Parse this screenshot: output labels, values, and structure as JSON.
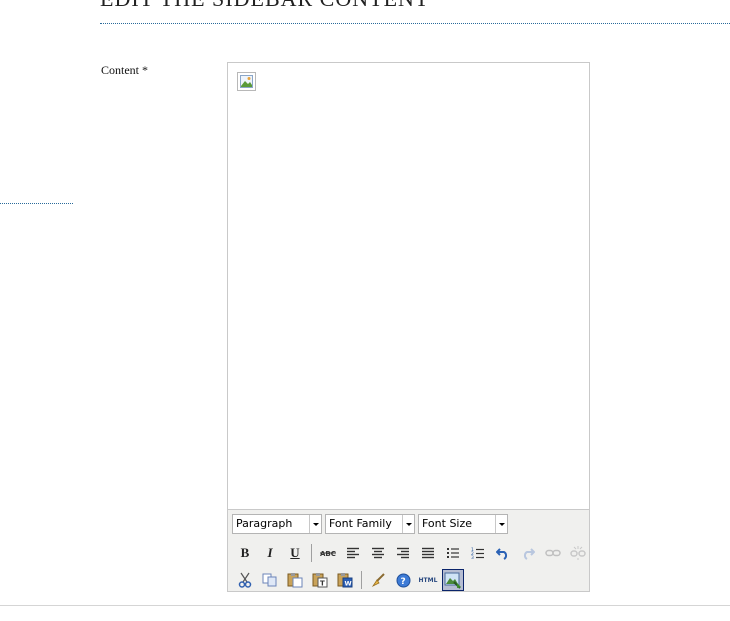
{
  "page": {
    "title": "EDIT THE SIDEBAR CONTENT"
  },
  "form": {
    "content_label": "Content *"
  },
  "editor": {
    "format_select": "Paragraph",
    "font_family_select": "Font Family",
    "font_size_select": "Font Size",
    "buttons": {
      "bold": "B",
      "italic": "I",
      "underline": "U",
      "html": "HTML"
    },
    "icons": [
      "bold-icon",
      "italic-icon",
      "underline-icon",
      "strikethrough-icon",
      "align-left-icon",
      "align-center-icon",
      "align-right-icon",
      "align-justify-icon",
      "bullet-list-icon",
      "numbered-list-icon",
      "undo-icon",
      "redo-icon",
      "link-icon",
      "unlink-icon",
      "cut-icon",
      "copy-icon",
      "paste-icon",
      "paste-text-icon",
      "paste-word-icon",
      "cleanup-icon",
      "help-icon",
      "html-icon",
      "insert-image-icon"
    ],
    "accent": "#0a246a"
  }
}
